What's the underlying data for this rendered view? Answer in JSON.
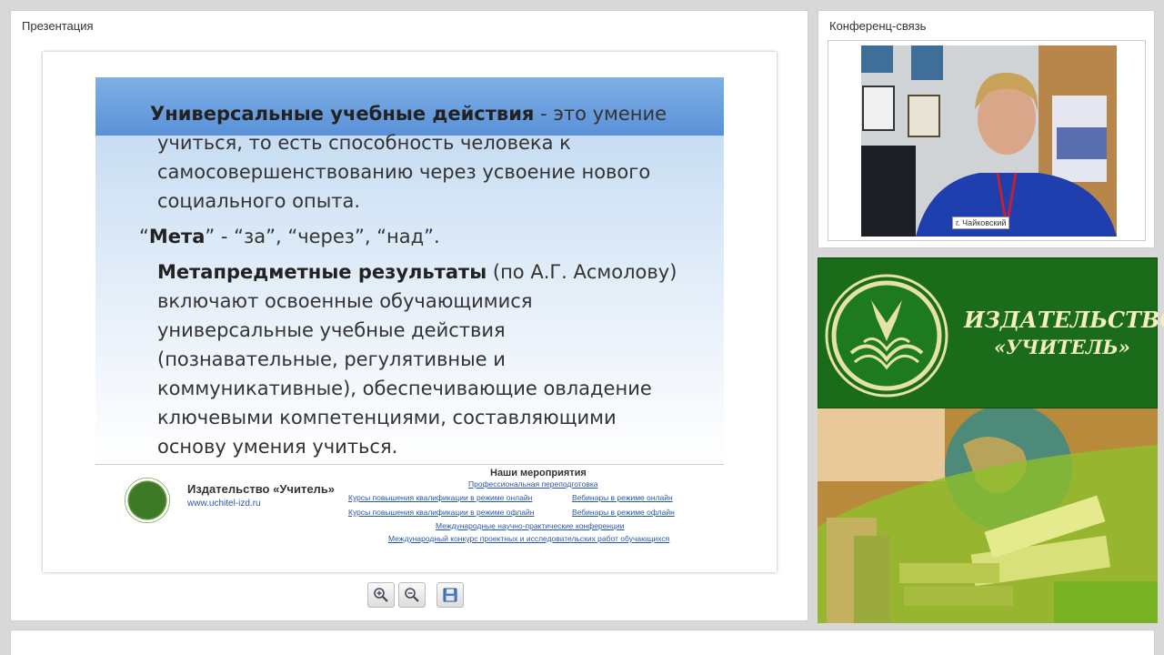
{
  "presentation": {
    "panel_title": "Презентация",
    "slide": {
      "heading_bold": "Универсальные учебные действия",
      "heading_rest": " - это умение",
      "def_line2": "учиться, то есть способность человека к",
      "def_line3": "самосовершенствованию через усвоение нового",
      "def_line4": "социального опыта.",
      "meta_open_quote": "“",
      "meta_word": "Мета",
      "meta_rest": "” - “за”, “через”, “над”.",
      "results_bold": "Метапредметные результаты",
      "results_rest": " (по А.Г. Асмолову)",
      "results_line2": "включают освоенные обучающимися",
      "results_line3": "универсальные учебные действия",
      "results_line4": "(познавательные, регулятивные и",
      "results_line5": "коммуникативные), обеспечивающие овладение",
      "results_line6": "ключевыми компетенциями, составляющими",
      "results_line7": "основу умения учиться."
    },
    "footer": {
      "publisher": "Издательство «Учитель»",
      "url": "www.uchitel-izd.ru",
      "events_title": "Наши мероприятия",
      "events": [
        "Профессиональная переподготовка",
        "Курсы повышения квалификации в режиме онлайн",
        "Вебинары в режиме онлайн",
        "Курсы повышения квалификации в режиме офлайн",
        "Вебинары в режиме офлайн",
        "Международные научно-практические конференции",
        "Международный конкурс проектных и исследовательских работ обучающихся"
      ]
    },
    "toolbar": {
      "zoom_in": "zoom-in-icon",
      "zoom_out": "zoom-out-icon",
      "save": "save-icon"
    }
  },
  "conference": {
    "panel_title": "Конференц-связь",
    "video_label": "г. Чайковский"
  },
  "banner": {
    "title_line1": "ИЗДАТЕЛЬСТВО",
    "title_line2": "«УЧИТЕЛЬ»"
  },
  "colors": {
    "slide_header": "#5a91d8",
    "banner_green": "#1a6b1a",
    "link_blue": "#2b57a8"
  }
}
